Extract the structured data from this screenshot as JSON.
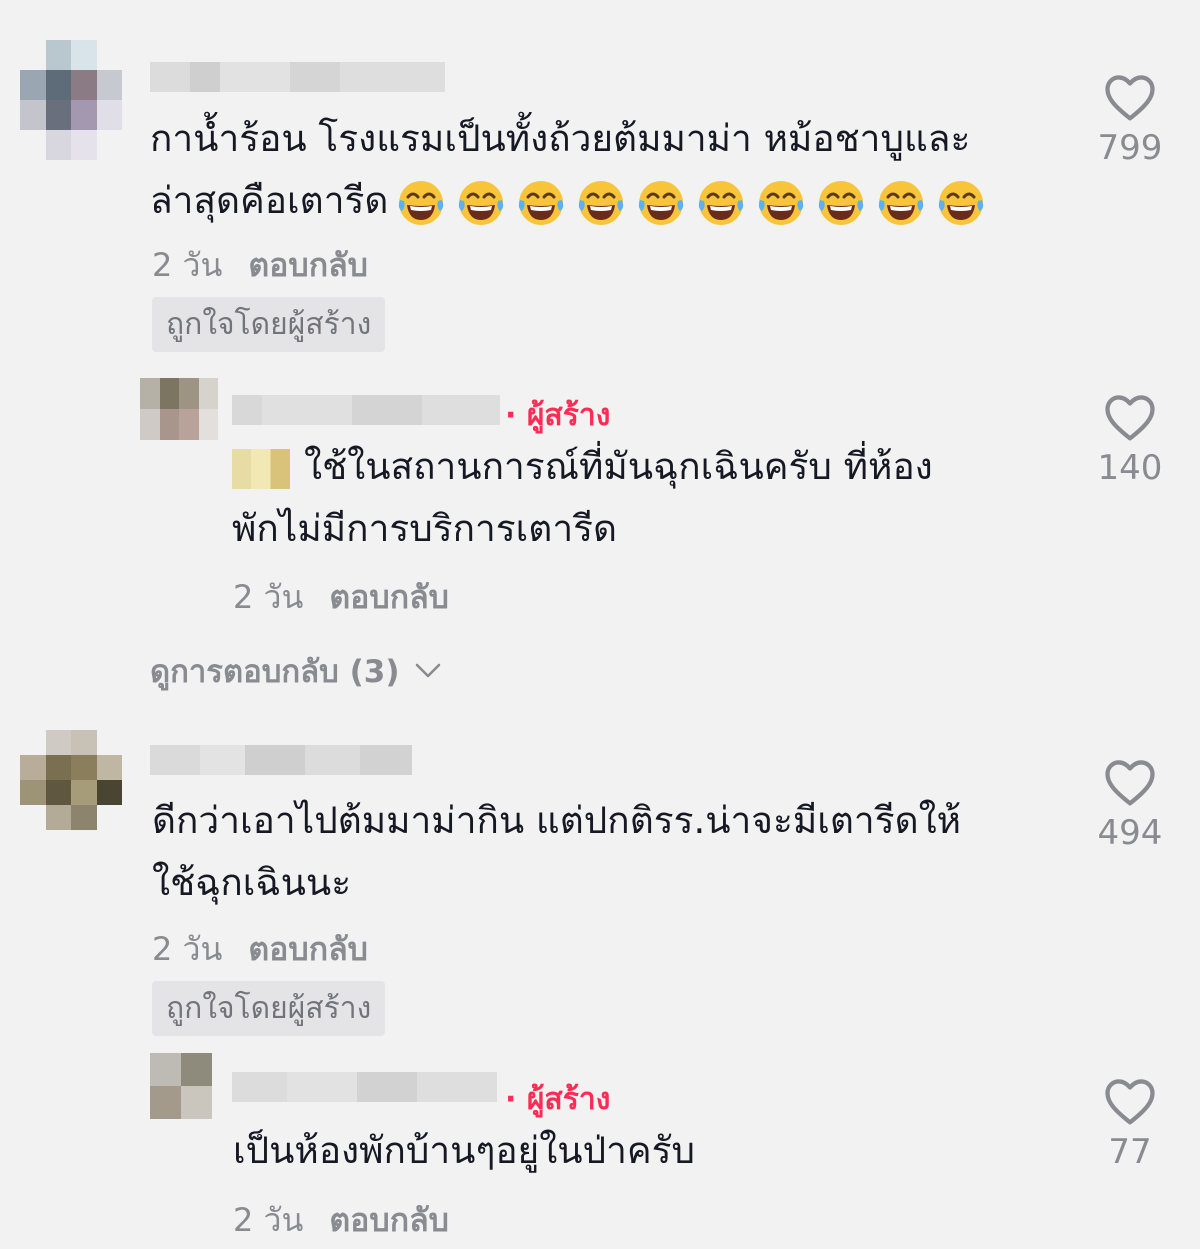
{
  "comments": [
    {
      "text_line1": "กาน้ำร้อน โรงแรมเป็นทั้งถ้วยต้มมาม่า หม้อชาบูและ",
      "text_line2": "ล่าสุดคือเตารีด",
      "emoji": "face-with-tears-of-joy",
      "emoji_count": 10,
      "time": "2 วัน",
      "reply_label": "ตอบกลับ",
      "liked_by_creator": "ถูกใจโดยผู้สร้าง",
      "likes": "799"
    },
    {
      "text_line1": "ดีกว่าเอาไปต้มมาม่ากิน แต่ปกติรร.น่าจะมีเตารีดให้",
      "text_line2": "ใช้ฉุกเฉินนะ",
      "time": "2 วัน",
      "reply_label": "ตอบกลับ",
      "liked_by_creator": "ถูกใจโดยผู้สร้าง",
      "likes": "494"
    }
  ],
  "replies": [
    {
      "creator_tag": "· ผู้สร้าง",
      "text_line1": "ใช้ในสถานการณ์ที่มันฉุกเฉินครับ ที่ห้อง",
      "text_line2": "พักไม่มีการบริการเตารีด",
      "time": "2 วัน",
      "reply_label": "ตอบกลับ",
      "likes": "140"
    },
    {
      "creator_tag": "· ผู้สร้าง",
      "text_line1": "เป็นห้องพักบ้านๆอยู่ในป่าครับ",
      "time": "2 วัน",
      "reply_label": "ตอบกลับ",
      "likes": "77"
    }
  ],
  "view_replies": "ดูการตอบกลับ (3)",
  "colors": {
    "background": "#f2f2f2",
    "text": "#161823",
    "muted": "#8a8b91",
    "creator": "#fe2c55"
  },
  "icons": [
    "heart-outline-icon",
    "chevron-down-icon",
    "face-with-tears-of-joy-emoji"
  ]
}
